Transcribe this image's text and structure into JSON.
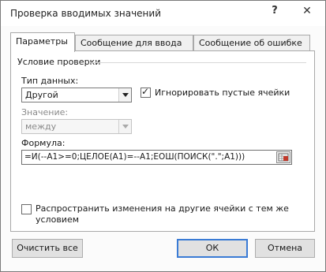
{
  "window": {
    "title": "Проверка вводимых значений",
    "help_label": "?",
    "close_label": "✕"
  },
  "tabs": [
    {
      "label": "Параметры",
      "active": true
    },
    {
      "label": "Сообщение для ввода",
      "active": false
    },
    {
      "label": "Сообщение об ошибке",
      "active": false
    }
  ],
  "settings": {
    "section_label": "Условие проверки",
    "data_type_label": "Тип данных:",
    "data_type_value": "Другой",
    "ignore_blank_label": "Игнорировать пустые ячейки",
    "ignore_blank_checked": true,
    "value_label": "Значение:",
    "value_value": "между",
    "formula_label": "Формула:",
    "formula_value": "=И(--A1>=0;ЦЕЛОЕ(A1)=--A1;ЕОШ(ПОИСК(\".\";A1)))",
    "apply_all_label_line1": "Распространить изменения на другие ячейки с тем же",
    "apply_all_label_line2": "условием",
    "apply_all_checked": false
  },
  "buttons": {
    "clear_all": "Очистить все",
    "ok": "ОК",
    "cancel": "Отмена"
  },
  "colors": {
    "accent": "#3a7bd5",
    "range_icon_red": "#c0392b"
  }
}
